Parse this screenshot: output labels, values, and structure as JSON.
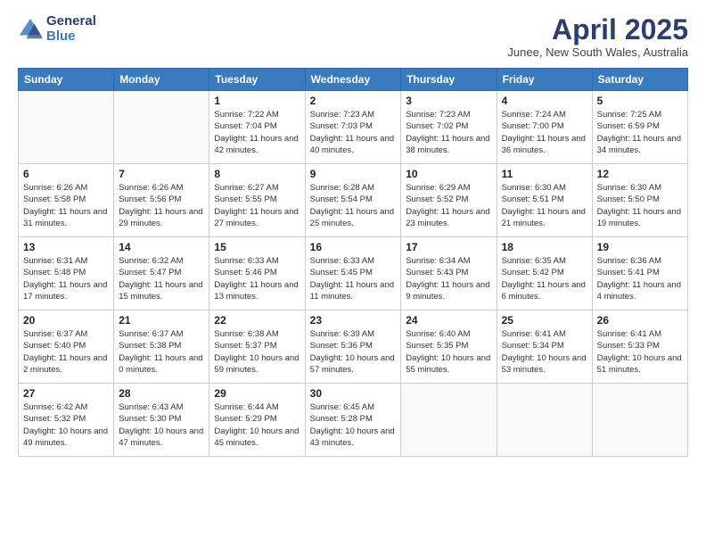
{
  "header": {
    "logo_general": "General",
    "logo_blue": "Blue",
    "month_title": "April 2025",
    "subtitle": "Junee, New South Wales, Australia"
  },
  "days_of_week": [
    "Sunday",
    "Monday",
    "Tuesday",
    "Wednesday",
    "Thursday",
    "Friday",
    "Saturday"
  ],
  "weeks": [
    [
      {
        "day": "",
        "info": ""
      },
      {
        "day": "",
        "info": ""
      },
      {
        "day": "1",
        "info": "Sunrise: 7:22 AM\nSunset: 7:04 PM\nDaylight: 11 hours and 42 minutes."
      },
      {
        "day": "2",
        "info": "Sunrise: 7:23 AM\nSunset: 7:03 PM\nDaylight: 11 hours and 40 minutes."
      },
      {
        "day": "3",
        "info": "Sunrise: 7:23 AM\nSunset: 7:02 PM\nDaylight: 11 hours and 38 minutes."
      },
      {
        "day": "4",
        "info": "Sunrise: 7:24 AM\nSunset: 7:00 PM\nDaylight: 11 hours and 36 minutes."
      },
      {
        "day": "5",
        "info": "Sunrise: 7:25 AM\nSunset: 6:59 PM\nDaylight: 11 hours and 34 minutes."
      }
    ],
    [
      {
        "day": "6",
        "info": "Sunrise: 6:26 AM\nSunset: 5:58 PM\nDaylight: 11 hours and 31 minutes."
      },
      {
        "day": "7",
        "info": "Sunrise: 6:26 AM\nSunset: 5:56 PM\nDaylight: 11 hours and 29 minutes."
      },
      {
        "day": "8",
        "info": "Sunrise: 6:27 AM\nSunset: 5:55 PM\nDaylight: 11 hours and 27 minutes."
      },
      {
        "day": "9",
        "info": "Sunrise: 6:28 AM\nSunset: 5:54 PM\nDaylight: 11 hours and 25 minutes."
      },
      {
        "day": "10",
        "info": "Sunrise: 6:29 AM\nSunset: 5:52 PM\nDaylight: 11 hours and 23 minutes."
      },
      {
        "day": "11",
        "info": "Sunrise: 6:30 AM\nSunset: 5:51 PM\nDaylight: 11 hours and 21 minutes."
      },
      {
        "day": "12",
        "info": "Sunrise: 6:30 AM\nSunset: 5:50 PM\nDaylight: 11 hours and 19 minutes."
      }
    ],
    [
      {
        "day": "13",
        "info": "Sunrise: 6:31 AM\nSunset: 5:48 PM\nDaylight: 11 hours and 17 minutes."
      },
      {
        "day": "14",
        "info": "Sunrise: 6:32 AM\nSunset: 5:47 PM\nDaylight: 11 hours and 15 minutes."
      },
      {
        "day": "15",
        "info": "Sunrise: 6:33 AM\nSunset: 5:46 PM\nDaylight: 11 hours and 13 minutes."
      },
      {
        "day": "16",
        "info": "Sunrise: 6:33 AM\nSunset: 5:45 PM\nDaylight: 11 hours and 11 minutes."
      },
      {
        "day": "17",
        "info": "Sunrise: 6:34 AM\nSunset: 5:43 PM\nDaylight: 11 hours and 9 minutes."
      },
      {
        "day": "18",
        "info": "Sunrise: 6:35 AM\nSunset: 5:42 PM\nDaylight: 11 hours and 6 minutes."
      },
      {
        "day": "19",
        "info": "Sunrise: 6:36 AM\nSunset: 5:41 PM\nDaylight: 11 hours and 4 minutes."
      }
    ],
    [
      {
        "day": "20",
        "info": "Sunrise: 6:37 AM\nSunset: 5:40 PM\nDaylight: 11 hours and 2 minutes."
      },
      {
        "day": "21",
        "info": "Sunrise: 6:37 AM\nSunset: 5:38 PM\nDaylight: 11 hours and 0 minutes."
      },
      {
        "day": "22",
        "info": "Sunrise: 6:38 AM\nSunset: 5:37 PM\nDaylight: 10 hours and 59 minutes."
      },
      {
        "day": "23",
        "info": "Sunrise: 6:39 AM\nSunset: 5:36 PM\nDaylight: 10 hours and 57 minutes."
      },
      {
        "day": "24",
        "info": "Sunrise: 6:40 AM\nSunset: 5:35 PM\nDaylight: 10 hours and 55 minutes."
      },
      {
        "day": "25",
        "info": "Sunrise: 6:41 AM\nSunset: 5:34 PM\nDaylight: 10 hours and 53 minutes."
      },
      {
        "day": "26",
        "info": "Sunrise: 6:41 AM\nSunset: 5:33 PM\nDaylight: 10 hours and 51 minutes."
      }
    ],
    [
      {
        "day": "27",
        "info": "Sunrise: 6:42 AM\nSunset: 5:32 PM\nDaylight: 10 hours and 49 minutes."
      },
      {
        "day": "28",
        "info": "Sunrise: 6:43 AM\nSunset: 5:30 PM\nDaylight: 10 hours and 47 minutes."
      },
      {
        "day": "29",
        "info": "Sunrise: 6:44 AM\nSunset: 5:29 PM\nDaylight: 10 hours and 45 minutes."
      },
      {
        "day": "30",
        "info": "Sunrise: 6:45 AM\nSunset: 5:28 PM\nDaylight: 10 hours and 43 minutes."
      },
      {
        "day": "",
        "info": ""
      },
      {
        "day": "",
        "info": ""
      },
      {
        "day": "",
        "info": ""
      }
    ]
  ]
}
